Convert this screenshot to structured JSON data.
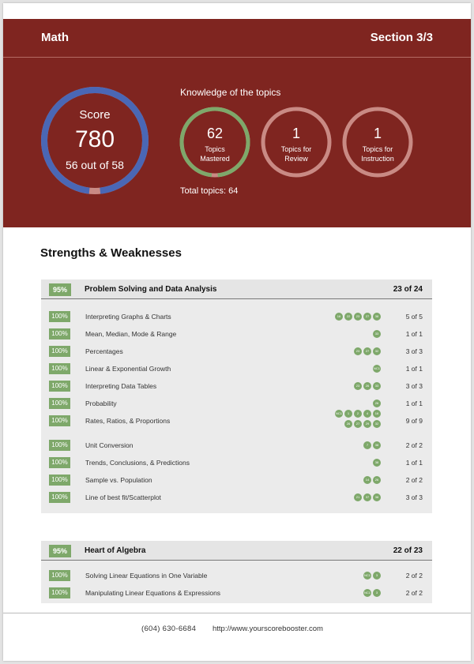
{
  "header": {
    "subject": "Math",
    "section": "Section 3/3"
  },
  "score": {
    "label": "Score",
    "value": "780",
    "correct": "56 out of 58",
    "fraction": 0.9655
  },
  "knowledge": {
    "title": "Knowledge of the topics",
    "topics": [
      {
        "value": "62",
        "line1": "Topics",
        "line2": "Mastered",
        "color": "#7ea86a"
      },
      {
        "value": "1",
        "line1": "Topics for",
        "line2": "Review",
        "color": "#c98a84"
      },
      {
        "value": "1",
        "line1": "Topics for",
        "line2": "Instruction",
        "color": "#c98a84"
      }
    ],
    "total": "Total topics: 64"
  },
  "sw_title": "Strengths & Weaknesses",
  "sections": [
    {
      "pct": "95%",
      "name": "Problem Solving and Data Analysis",
      "count": "23 of 24",
      "rows": [
        {
          "pct": "100%",
          "name": "Interpreting Graphs & Charts",
          "count": "5 of 5",
          "badges": [
            "16",
            "22",
            "23",
            "27",
            "38"
          ]
        },
        {
          "pct": "100%",
          "name": "Mean, Median, Mode & Range",
          "count": "1 of 1",
          "badges": [
            "33"
          ]
        },
        {
          "pct": "100%",
          "name": "Percentages",
          "count": "3 of 3",
          "badges": [
            "23",
            "27",
            "32"
          ]
        },
        {
          "pct": "100%",
          "name": "Linear & Exponential Growth",
          "count": "1 of 1",
          "badges": [
            "NC1"
          ]
        },
        {
          "pct": "100%",
          "name": "Interpreting Data Tables",
          "count": "3 of 3",
          "badges": [
            "23",
            "26",
            "33"
          ]
        },
        {
          "pct": "100%",
          "name": "Probability",
          "count": "1 of 1",
          "badges": [
            "26"
          ]
        },
        {
          "pct": "100%",
          "name": "Rates, Ratios, & Proportions",
          "count": "9 of 9",
          "badges": [
            "NC1",
            "1",
            "2",
            "4",
            "16",
            "26",
            "27",
            "29",
            "32"
          ]
        },
        {
          "pct": "100%",
          "name": "Unit Conversion",
          "count": "2 of 2",
          "badges": [
            "7",
            "38"
          ]
        },
        {
          "pct": "100%",
          "name": "Trends, Conclusions, & Predictions",
          "count": "1 of 1",
          "badges": [
            "38"
          ]
        },
        {
          "pct": "100%",
          "name": "Sample vs. Population",
          "count": "2 of 2",
          "badges": [
            "14",
            "26"
          ]
        },
        {
          "pct": "100%",
          "name": "Line of best fit/Scatterplot",
          "count": "3 of 3",
          "badges": [
            "21",
            "37",
            "38"
          ]
        }
      ]
    },
    {
      "pct": "95%",
      "name": "Heart of Algebra",
      "count": "22 of 23",
      "rows": [
        {
          "pct": "100%",
          "name": "Solving Linear Equations in One Variable",
          "count": "2 of 2",
          "badges": [
            "NC1",
            "3"
          ]
        },
        {
          "pct": "100%",
          "name": "Manipulating Linear Equations & Expressions",
          "count": "2 of 2",
          "badges": [
            "NC1",
            "3"
          ]
        }
      ]
    }
  ],
  "footer": {
    "phone": "(604) 630-6684",
    "website": "http://www.yourscorebooster.com"
  },
  "colors": {
    "brand": "#7f2520",
    "score_ring": "#4a67b5",
    "mastered": "#7ea86a",
    "pill": "#7ea86a"
  }
}
